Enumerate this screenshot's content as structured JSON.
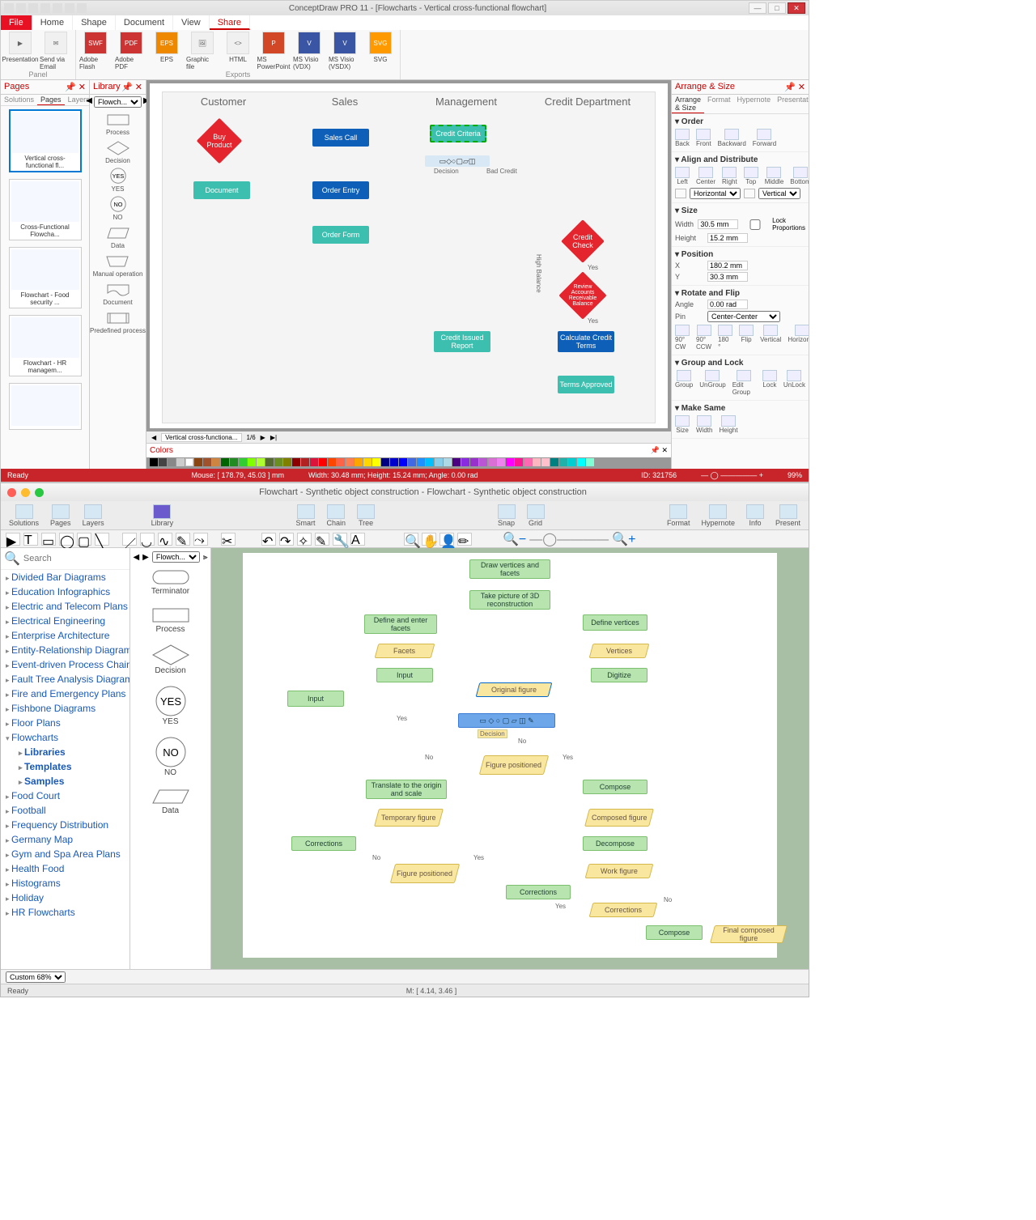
{
  "top": {
    "title": "ConceptDraw PRO 11 - [Flowcharts - Vertical cross-functional flowchart]",
    "menu_tabs": [
      "File",
      "Home",
      "Shape",
      "Document",
      "View",
      "Share"
    ],
    "active_tab": "Share",
    "ribbon": {
      "groups": [
        {
          "label": "Panel",
          "items": [
            {
              "label": "Presentation",
              "ico": "▶"
            },
            {
              "label": "Send via\nEmail",
              "ico": "✉"
            }
          ]
        },
        {
          "label": "Exports",
          "items": [
            {
              "label": "Adobe\nFlash",
              "ico": "SWF"
            },
            {
              "label": "Adobe\nPDF",
              "ico": "PDF"
            },
            {
              "label": "EPS",
              "ico": "EPS"
            },
            {
              "label": "Graphic\nfile",
              "ico": "IMG"
            },
            {
              "label": "HTML",
              "ico": "< >"
            },
            {
              "label": "MS\nPowerPoint",
              "ico": "P"
            },
            {
              "label": "MS Visio\n(VDX)",
              "ico": "V"
            },
            {
              "label": "MS Visio\n(VSDX)",
              "ico": "V"
            },
            {
              "label": "SVG",
              "ico": "SVG"
            }
          ]
        }
      ]
    },
    "pages_panel": {
      "title": "Pages",
      "tabs": [
        "Solutions",
        "Pages",
        "Layers"
      ],
      "thumbs": [
        "Vertical cross-functional fl...",
        "Cross-Functional Flowcha...",
        "Flowchart - Food security ...",
        "Flowchart - HR managem..."
      ]
    },
    "library_panel": {
      "title": "Library",
      "select": "Flowch...",
      "shapes": [
        "Process",
        "Decision",
        "YES",
        "NO",
        "Data",
        "Manual operation",
        "Document",
        "Predefined process"
      ]
    },
    "right_panel": {
      "title": "Arrange & Size",
      "tabs": [
        "Arrange & Size",
        "Format",
        "Hypernote",
        "Presentation"
      ],
      "order": [
        "Back",
        "Front",
        "Backward",
        "Forward"
      ],
      "align": [
        "Left",
        "Center",
        "Right",
        "Top",
        "Middle",
        "Bottom"
      ],
      "align_drop1": "Horizontal",
      "align_drop2": "Vertical",
      "size": {
        "w_lbl": "Width",
        "w": "30.5 mm",
        "h_lbl": "Height",
        "h": "15.2 mm",
        "lock": "Lock Proportions"
      },
      "position": {
        "x_lbl": "X",
        "x": "180.2 mm",
        "y_lbl": "Y",
        "y": "30.3 mm"
      },
      "rotate": {
        "a_lbl": "Angle",
        "a": "0.00 rad",
        "p_lbl": "Pin",
        "p": "Center-Center",
        "btns": [
          "90° CW",
          "90° CCW",
          "180 °",
          "Flip",
          "Vertical",
          "Horizontal"
        ]
      },
      "group": [
        "Group",
        "UnGroup",
        "Edit Group",
        "Lock",
        "UnLock"
      ],
      "makesame": [
        "Size",
        "Width",
        "Height"
      ]
    },
    "canvas": {
      "lanes": [
        "Customer",
        "Sales",
        "Management",
        "Credit Department"
      ],
      "shapes": {
        "buy": "Buy Product",
        "sales_call": "Sales Call",
        "criteria": "Credit Criteria",
        "decision": "Decision",
        "bad": "Bad Credit",
        "doc": "Document",
        "order_entry": "Order Entry",
        "order_form": "Order Form",
        "credit_check": "Credit Check",
        "yes": "Yes",
        "review": "Review Accounts Receivable Balance",
        "high": "High Balance",
        "calc": "Calculate Credit Terms",
        "issued": "Credit Issued Report",
        "approved": "Terms Approved"
      }
    },
    "tabs_row": {
      "name": "Vertical cross-functiona...",
      "page": "1/6"
    },
    "colors_lbl": "Colors",
    "status": {
      "ready": "Ready",
      "mouse": "Mouse: [ 178.79, 45.03 ] mm",
      "dims": "Width: 30.48 mm;   Height: 15.24 mm;   Angle: 0.00 rad",
      "id": "ID: 321756",
      "zoom": "99%"
    }
  },
  "bot": {
    "title": "Flowchart - Synthetic object construction - Flowchart - Synthetic object construction",
    "toolbar": [
      "Solutions",
      "Pages",
      "Layers",
      "",
      "Library",
      "",
      "Smart",
      "Chain",
      "Tree",
      "",
      "Snap",
      "Grid",
      "",
      "Format",
      "Hypernote",
      "Info",
      "Present"
    ],
    "search_ph": "Search",
    "tree": [
      "Divided Bar Diagrams",
      "Education Infographics",
      "Electric and Telecom Plans",
      "Electrical Engineering",
      "Enterprise Architecture",
      "Entity-Relationship Diagram",
      "Event-driven Process Chain",
      "Fault Tree Analysis Diagrams",
      "Fire and Emergency Plans",
      "Fishbone Diagrams",
      "Floor Plans"
    ],
    "tree_open": "Flowcharts",
    "tree_sub": [
      "Libraries",
      "Templates",
      "Samples"
    ],
    "tree2": [
      "Food Court",
      "Football",
      "Frequency Distribution",
      "Germany Map",
      "Gym and Spa Area Plans",
      "Health Food",
      "Histograms",
      "Holiday",
      "HR Flowcharts"
    ],
    "lib": {
      "select": "Flowch...",
      "shapes": [
        "Terminator",
        "Process",
        "Decision",
        "YES",
        "NO",
        "Data"
      ]
    },
    "nodes": {
      "n1": "Draw vertices and facets",
      "n2": "Take picture of 3D reconstruction",
      "n3": "Define and enter facets",
      "n4": "Define vertices",
      "n5": "Facets",
      "n6": "Vertices",
      "n7": "Input",
      "n8": "Digitize",
      "n9": "Original figure",
      "n10": "Input",
      "n11": "Decision",
      "n12": "Figure positioned",
      "n13": "Translate to the origin and scale",
      "n14": "Compose",
      "n15": "Temporary figure",
      "n16": "Composed figure",
      "n17": "Corrections",
      "n18": "Decompose",
      "n19": "Figure positioned",
      "n20": "Work figure",
      "n21": "Corrections",
      "n22": "Corrections",
      "n23": "Compose",
      "n24": "Final composed figure",
      "yes": "Yes",
      "no": "No"
    },
    "zoom_sel": "Custom 68%",
    "status": {
      "ready": "Ready",
      "m": "M: [ 4.14, 3.46 ]"
    }
  }
}
